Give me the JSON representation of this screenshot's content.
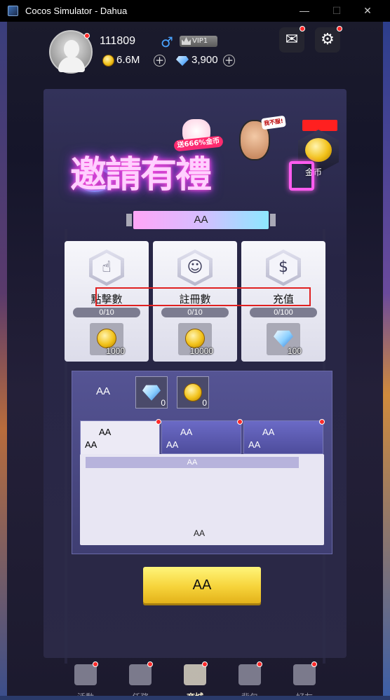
{
  "window": {
    "title": "Cocos Simulator - Dahua",
    "controls": [
      "minimize",
      "maximize",
      "close"
    ]
  },
  "player": {
    "id": "111809",
    "vip_label": "VIP1",
    "gold": "6.6M",
    "gems": "3,900"
  },
  "header_icons": [
    "mail-icon",
    "gear-icon"
  ],
  "promo": {
    "title": "邀請有禮",
    "cat_banner": "送666%金币",
    "face_bubble": "我不服!",
    "coin_caption": "金币"
  },
  "banner": {
    "label": "AA"
  },
  "cards": [
    {
      "label": "點擊數",
      "icon": "tap-hand-icon",
      "progress": "0/10",
      "reward_type": "coin",
      "reward_value": "1000"
    },
    {
      "label": "註冊數",
      "icon": "user-icon",
      "progress": "0/10",
      "reward_type": "coin",
      "reward_value": "10000"
    },
    {
      "label": "充值",
      "icon": "dollar-coin-icon",
      "progress": "0/100",
      "reward_type": "gem",
      "reward_value": "100"
    }
  ],
  "rewards_summary": {
    "label": "AA",
    "gem_count": "0",
    "coin_count": "0"
  },
  "tabs": [
    {
      "title": "AA",
      "subtitle": "AA",
      "active": true
    },
    {
      "title": "AA",
      "subtitle": "AA",
      "active": false
    },
    {
      "title": "AA",
      "subtitle": "AA",
      "active": false
    }
  ],
  "tab_content": {
    "header_strip": "AA",
    "footer_text": "AA"
  },
  "action_button": {
    "label": "AA"
  },
  "nav": [
    {
      "label": "活動",
      "icon": "activity-icon",
      "active": false
    },
    {
      "label": "任務",
      "icon": "task-calendar-icon",
      "active": false
    },
    {
      "label": "商城",
      "icon": "shop-cart-icon",
      "active": true
    },
    {
      "label": "背包",
      "icon": "backpack-icon",
      "active": false
    },
    {
      "label": "好友",
      "icon": "friends-icon",
      "active": false
    }
  ],
  "colors": {
    "accent_gold": "#f6d33a",
    "neon_pink": "#ff4fd8",
    "neon_cyan": "#3fe0ff",
    "highlight_box": "#e02020",
    "notify_dot": "#ff2a2a"
  }
}
